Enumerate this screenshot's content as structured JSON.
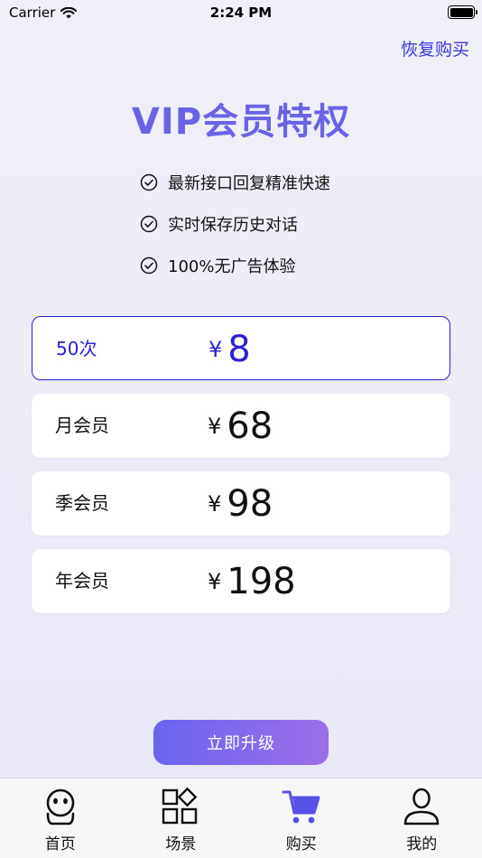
{
  "status_bar": {
    "carrier": "Carrier",
    "time": "2:24 PM"
  },
  "header": {
    "restore_label": "恢复购买"
  },
  "title": "VIP会员特权",
  "features": [
    {
      "label": "最新接口回复精准快速",
      "icon": "check-circle-icon"
    },
    {
      "label": "实时保存历史对话",
      "icon": "check-circle-icon"
    },
    {
      "label": "100%无广告体验",
      "icon": "check-circle-icon"
    }
  ],
  "plans": [
    {
      "name": "50次",
      "currency": "¥",
      "price": "8",
      "selected": true
    },
    {
      "name": "月会员",
      "currency": "¥",
      "price": "68",
      "selected": false
    },
    {
      "name": "季会员",
      "currency": "¥",
      "price": "98",
      "selected": false
    },
    {
      "name": "年会员",
      "currency": "¥",
      "price": "198",
      "selected": false
    }
  ],
  "upgrade_button": {
    "label": "立即升级"
  },
  "tab_bar": {
    "items": [
      {
        "label": "首页",
        "icon": "robot-icon",
        "active": false
      },
      {
        "label": "场景",
        "icon": "grid-icon",
        "active": false
      },
      {
        "label": "购买",
        "icon": "cart-icon",
        "active": true
      },
      {
        "label": "我的",
        "icon": "person-icon",
        "active": false
      }
    ]
  },
  "colors": {
    "accent": "#2a22d8",
    "title": "#6b63e6",
    "button_start": "#6b65ee",
    "button_end": "#9b6ee8"
  }
}
